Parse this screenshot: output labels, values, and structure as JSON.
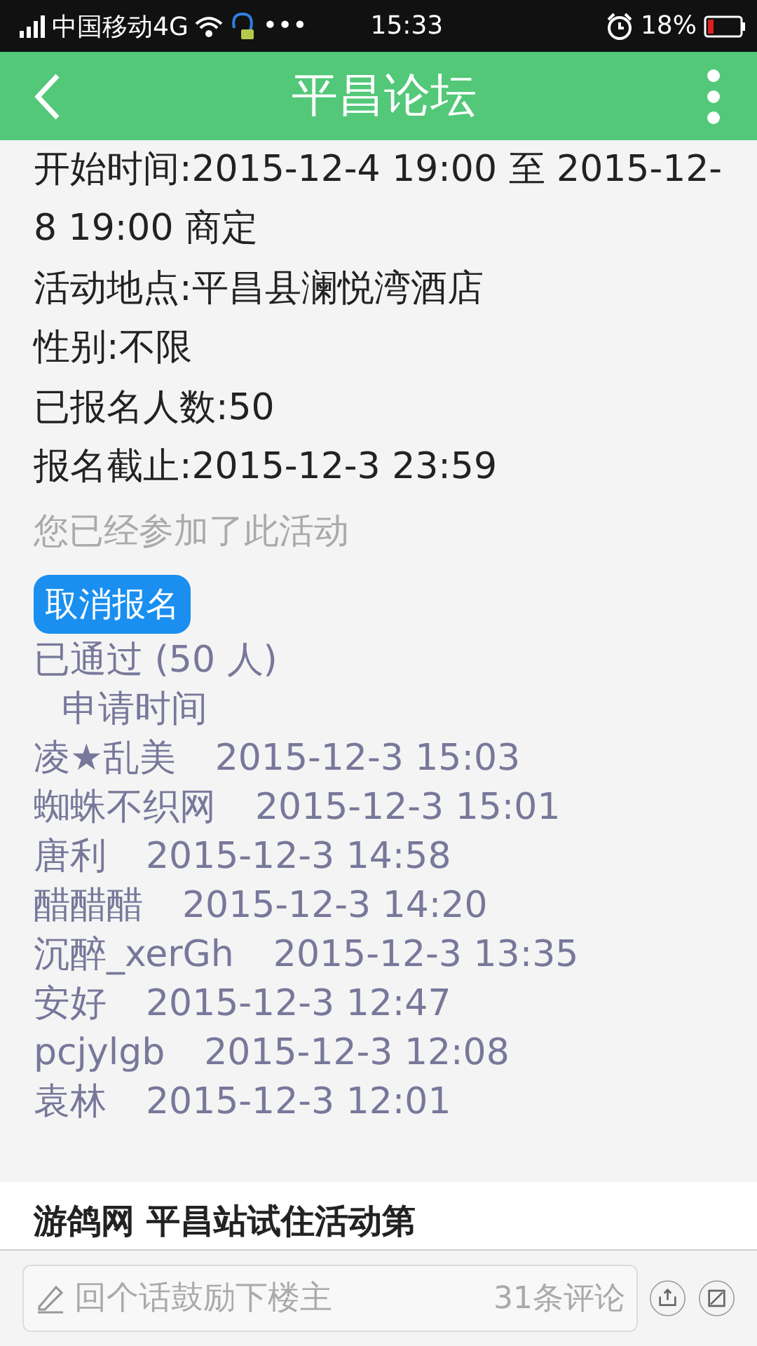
{
  "status_bar": {
    "carrier": "中国移动4G",
    "more": "•••",
    "time": "15:33",
    "battery": "18%"
  },
  "header": {
    "title": "平昌论坛"
  },
  "details": [
    "开始时间:2015-12-4 19:00 至 2015-12-8 19:00 商定",
    "活动地点:平昌县澜悦湾酒店",
    "性别:不限",
    "已报名人数:50",
    "报名截止:2015-12-3 23:59"
  ],
  "notice": "您已经参加了此活动",
  "cancel_button": "取消报名",
  "approved": {
    "title": "已通过 (50 人)",
    "column": "申请时间",
    "rows": [
      {
        "name": "凌★乱美",
        "time": "2015-12-3 15:03"
      },
      {
        "name": "蜘蛛不织网",
        "time": "2015-12-3 15:01"
      },
      {
        "name": "唐利",
        "time": "2015-12-3 14:58"
      },
      {
        "name": "醋醋醋",
        "time": "2015-12-3 14:20"
      },
      {
        "name": "沉醉_xerGh",
        "time": "2015-12-3 13:35"
      },
      {
        "name": "安好",
        "time": "2015-12-3 12:47"
      },
      {
        "name": "pcjylgb",
        "time": "2015-12-3 12:08"
      },
      {
        "name": "袁林",
        "time": "2015-12-3 12:01"
      }
    ]
  },
  "next_post": {
    "title": "游鸽网 平昌站试住活动第"
  },
  "bottom_bar": {
    "placeholder": "回个话鼓励下楼主",
    "comments": "31条评论"
  }
}
